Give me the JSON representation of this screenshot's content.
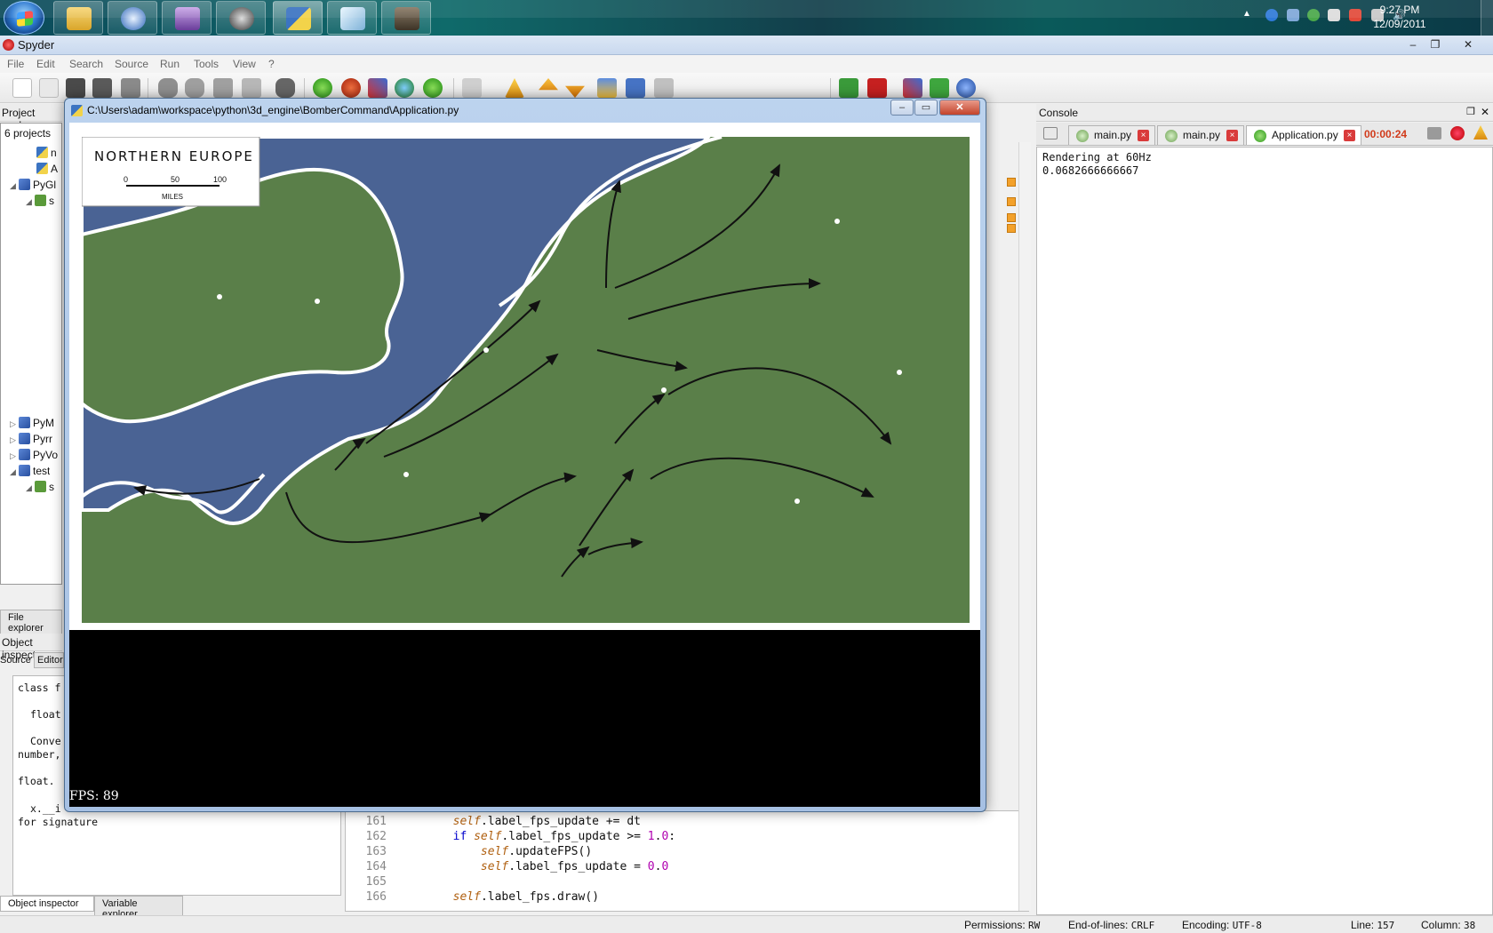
{
  "taskbar": {
    "clock_time": "9:27 PM",
    "clock_date": "12/09/2011",
    "pinned_icons": [
      "explorer-icon",
      "browser-icon",
      "pidgin-icon",
      "steam-icon",
      "python-icon",
      "notepad-icon",
      "gimp-icon"
    ]
  },
  "spyder": {
    "title": "Spyder",
    "menu": [
      "File",
      "Edit",
      "Search",
      "Source",
      "Run",
      "Tools",
      "View",
      "?"
    ],
    "project_explorer": {
      "title": "Project explor",
      "count": "6 projects",
      "items": [
        "n",
        "A",
        "PyGl",
        "s",
        "PyM",
        "Pyrr",
        "PyVo",
        "test",
        "s"
      ]
    },
    "left_tabs": {
      "file_explorer": "File explorer",
      "object_inspector_title": "Object inspect",
      "source_label": "Source",
      "editor_tab": "Editor"
    },
    "inspector_lines": [
      "class f",
      "float",
      "Conve",
      "number,",
      "float.",
      "x.__i",
      "for signature"
    ],
    "bottom_tabs": [
      "Object inspector",
      "Variable explorer"
    ],
    "editor": {
      "lines": [
        {
          "num": "161",
          "indent": "        ",
          "code": "self.label_fps_update += dt"
        },
        {
          "num": "162",
          "indent": "        ",
          "code": "if self.label_fps_update >= 1.0:"
        },
        {
          "num": "163",
          "indent": "            ",
          "code": "self.updateFPS()"
        },
        {
          "num": "164",
          "indent": "            ",
          "code": "self.label_fps_update = 0.0"
        },
        {
          "num": "165",
          "indent": "",
          "code": ""
        },
        {
          "num": "166",
          "indent": "        ",
          "code": "self.label_fps.draw()"
        }
      ]
    },
    "console": {
      "title": "Console",
      "tabs": [
        {
          "label": "main.py",
          "selected": false
        },
        {
          "label": "main.py",
          "selected": false
        },
        {
          "label": "Application.py",
          "selected": true
        }
      ],
      "timer": "00:00:24",
      "output": [
        "Rendering at 60Hz",
        "0.0682666666667"
      ]
    },
    "status": {
      "permissions_label": "Permissions:",
      "permissions": "RW",
      "eol_label": "End-of-lines:",
      "eol": "CRLF",
      "encoding_label": "Encoding:",
      "encoding": "UTF-8",
      "line_label": "Line:",
      "line": "157",
      "column_label": "Column:",
      "column": "38"
    }
  },
  "app_window": {
    "title": "C:\\Users\\adam\\workspace\\python\\3d_engine\\BomberCommand\\Application.py",
    "map": {
      "title": "NORTHERN  EUROPE",
      "scale_ticks": [
        "0",
        "50",
        "100"
      ],
      "scale_unit": "MILES",
      "colors": {
        "sea": "#4a6394",
        "land": "#5a7f49",
        "coast": "#ffffff"
      }
    },
    "fps_label": "FPS: 89"
  },
  "colors": {
    "accent_red": "#c62020",
    "timer_color": "#d13a1a"
  }
}
